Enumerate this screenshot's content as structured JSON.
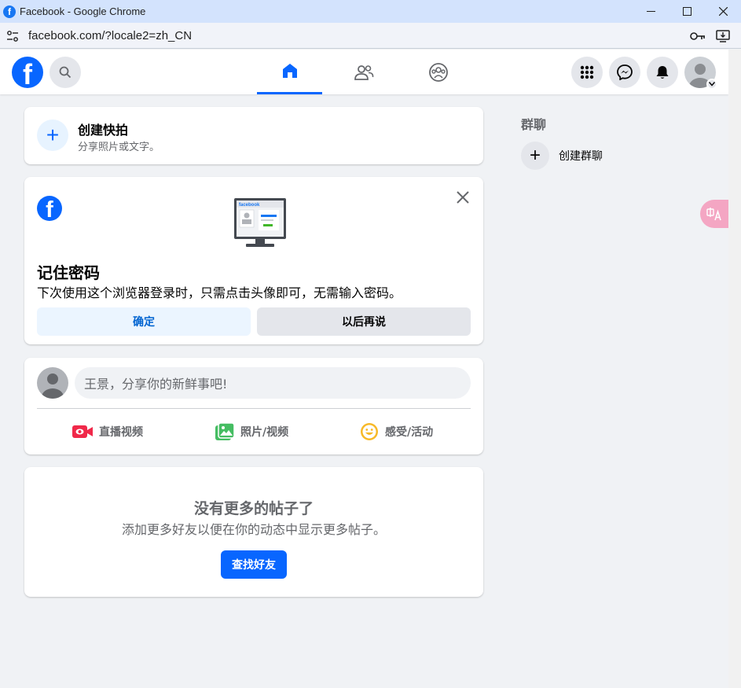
{
  "browser": {
    "tab_title": "Facebook - Google Chrome",
    "url": "facebook.com/?locale2=zh_CN"
  },
  "nav": {
    "logo_letter": "f",
    "tabs": [
      {
        "name": "home",
        "active": true
      },
      {
        "name": "friends",
        "active": false
      },
      {
        "name": "groups",
        "active": false
      }
    ]
  },
  "story": {
    "title": "创建快拍",
    "subtitle": "分享照片或文字。"
  },
  "remember_password": {
    "title": "记住密码",
    "description": "下次使用这个浏览器登录时，只需点击头像即可，无需输入密码。",
    "confirm_label": "确定",
    "later_label": "以后再说",
    "monitor_brand": "facebook"
  },
  "composer": {
    "placeholder": "王景，分享你的新鲜事吧!",
    "actions": [
      {
        "label": "直播视频",
        "icon": "live-video-icon",
        "color": "#f02849"
      },
      {
        "label": "照片/视频",
        "icon": "photo-video-icon",
        "color": "#45bd62"
      },
      {
        "label": "感受/活动",
        "icon": "feeling-icon",
        "color": "#f7b928"
      }
    ]
  },
  "no_more_posts": {
    "title": "没有更多的帖子了",
    "subtitle": "添加更多好友以便在你的动态中显示更多帖子。",
    "button_label": "查找好友"
  },
  "sidebar_right": {
    "heading": "群聊",
    "create_group_label": "创建群聊"
  },
  "colors": {
    "brand_blue": "#0866ff",
    "page_bg": "#f0f2f5"
  }
}
